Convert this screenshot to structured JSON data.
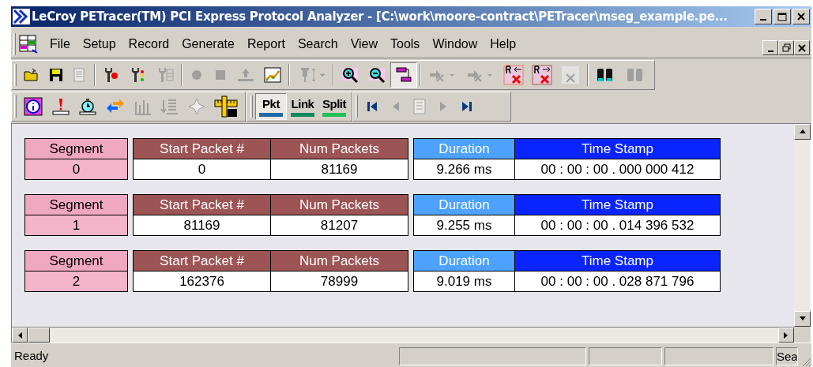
{
  "window": {
    "title": "LeCroy PETracer(TM) PCI Express Protocol Analyzer - [C:\\work\\moore-contract\\PETracer\\mseg_example.pe..."
  },
  "menu": [
    "File",
    "Setup",
    "Record",
    "Generate",
    "Report",
    "Search",
    "View",
    "Tools",
    "Window",
    "Help"
  ],
  "toolbar_1": [
    [
      {
        "kind": "open",
        "disabled": false
      },
      {
        "kind": "save",
        "disabled": false
      },
      {
        "kind": "edit",
        "disabled": true
      }
    ],
    [
      {
        "kind": "wrench-red",
        "disabled": false
      },
      {
        "kind": "wrench-lights",
        "disabled": false
      },
      {
        "kind": "wrench-grid",
        "disabled": true
      }
    ],
    [
      {
        "kind": "record",
        "disabled": true
      },
      {
        "kind": "stop",
        "disabled": true
      },
      {
        "kind": "upload",
        "disabled": true
      },
      {
        "kind": "rt-chart",
        "disabled": false
      }
    ],
    [
      {
        "kind": "plug-dropdown",
        "disabled": true
      }
    ],
    [
      {
        "kind": "zoom-in",
        "disabled": false
      },
      {
        "kind": "zoom-out",
        "disabled": false
      },
      {
        "kind": "wrap",
        "disabled": false,
        "pressed": true
      }
    ],
    [
      {
        "kind": "hide-dropdown",
        "disabled": true
      },
      {
        "kind": "hide-dropdown",
        "disabled": true
      },
      {
        "kind": "r-left-x",
        "disabled": false
      },
      {
        "kind": "r-right-x",
        "disabled": false
      },
      {
        "kind": "grid-x",
        "disabled": true
      }
    ],
    [
      {
        "kind": "binoculars",
        "disabled": false
      },
      {
        "kind": "binoculars-next",
        "disabled": true
      }
    ]
  ],
  "toolbar_2": [
    [
      {
        "kind": "info",
        "disabled": false
      },
      {
        "kind": "alert",
        "disabled": false
      },
      {
        "kind": "timer",
        "disabled": false
      },
      {
        "kind": "swap",
        "disabled": false
      },
      {
        "kind": "bars",
        "disabled": true
      },
      {
        "kind": "list-down",
        "disabled": true
      },
      {
        "kind": "star",
        "disabled": true
      },
      {
        "kind": "ruler",
        "disabled": false
      }
    ]
  ],
  "view_buttons": [
    {
      "label": "Pkt",
      "color": "#1f6aa5",
      "selected": true
    },
    {
      "label": "Link",
      "color": "#138a5e",
      "selected": false
    },
    {
      "label": "Split",
      "color": "#1fc15a",
      "selected": false
    }
  ],
  "nav_buttons": [
    {
      "kind": "first",
      "disabled": false
    },
    {
      "kind": "prev",
      "disabled": true
    },
    {
      "kind": "list",
      "disabled": true
    },
    {
      "kind": "next",
      "disabled": true
    },
    {
      "kind": "last",
      "disabled": false
    }
  ],
  "segments": [
    {
      "segment_label": "Segment",
      "segment": "0",
      "start_label": "Start Packet #",
      "start": "0",
      "num_label": "Num Packets",
      "num": "81169",
      "duration_label": "Duration",
      "duration": "9.266 ms",
      "timestamp_label": "Time Stamp",
      "timestamp": "00 : 00 : 00 . 000 000 412"
    },
    {
      "segment_label": "Segment",
      "segment": "1",
      "start_label": "Start Packet #",
      "start": "81169",
      "num_label": "Num Packets",
      "num": "81207",
      "duration_label": "Duration",
      "duration": "9.255 ms",
      "timestamp_label": "Time Stamp",
      "timestamp": "00 : 00 : 00 . 014 396 532"
    },
    {
      "segment_label": "Segment",
      "segment": "2",
      "start_label": "Start Packet #",
      "start": "162376",
      "num_label": "Num Packets",
      "num": "78999",
      "duration_label": "Duration",
      "duration": "9.019 ms",
      "timestamp_label": "Time Stamp",
      "timestamp": "00 : 00 : 00 . 028 871 796"
    }
  ],
  "status_bar": {
    "message": "Ready",
    "pane_4": "Sea"
  }
}
